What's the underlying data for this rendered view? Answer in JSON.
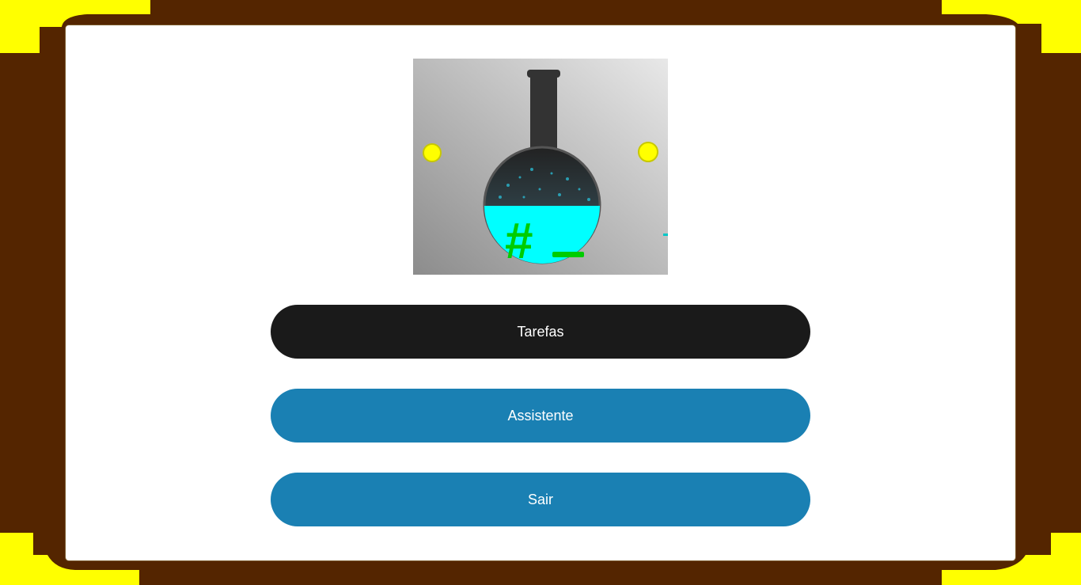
{
  "menu": {
    "tasks_label": "Tarefas",
    "assistant_label": "Assistente",
    "exit_label": "Sair"
  },
  "logo": {
    "icon": "flask-icon",
    "symbol": "#"
  },
  "colors": {
    "frame_brown": "#542500",
    "corner_yellow": "#ffff00",
    "panel_white": "#ffffff",
    "tasks_button": "#1a1a1a",
    "menu_button_blue": "#1a80b3",
    "liquid_cyan": "#00ffff",
    "symbol_green": "#00cc00"
  }
}
